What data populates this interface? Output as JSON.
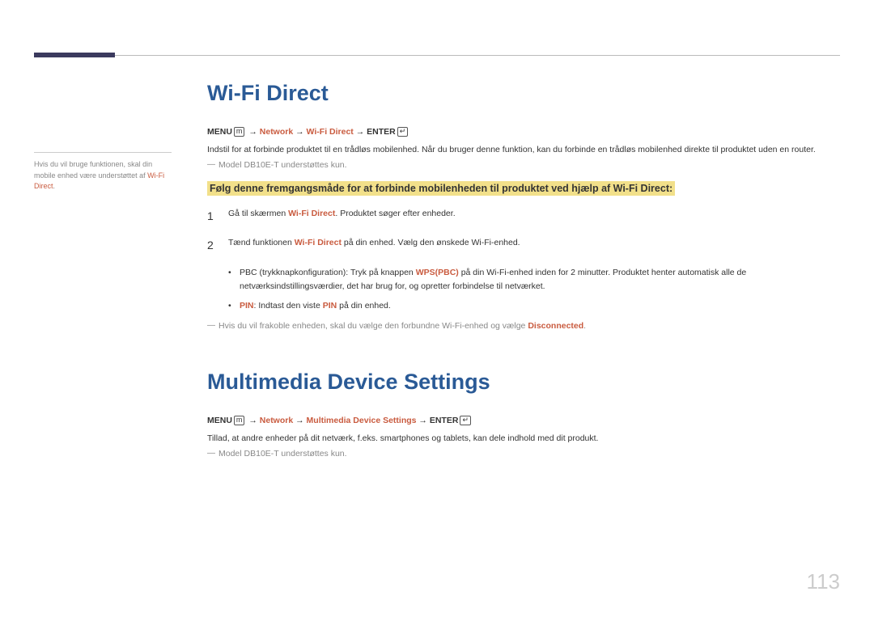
{
  "sidebar": {
    "text_a": "Hvis du vil bruge funktionen, skal din mobile enhed være understøttet af ",
    "hl": "Wi-Fi Direct",
    "text_b": "."
  },
  "section1": {
    "title": "Wi-Fi Direct",
    "path": {
      "menu": "MENU",
      "menu_icon": "m",
      "arrow1": " → ",
      "network": "Network",
      "arrow2": " → ",
      "item": "Wi-Fi Direct",
      "arrow3": " → ",
      "enter": "ENTER",
      "enter_icon": "↵"
    },
    "desc": "Indstil for at forbinde produktet til en trådløs mobilenhed. Når du bruger denne funktion, kan du forbinde en trådløs mobilenhed direkte til produktet uden en router.",
    "note": "Model DB10E-T understøttes kun.",
    "callout": "Følg denne fremgangsmåde for at forbinde mobilenheden til produktet ved hjælp af Wi-Fi Direct:",
    "step1": {
      "num": "1",
      "a": "Gå til skærmen ",
      "hl": "Wi-Fi Direct",
      "b": ". Produktet søger efter enheder."
    },
    "step2": {
      "num": "2",
      "a": "Tænd funktionen ",
      "hl": "Wi-Fi Direct",
      "b": " på din enhed. Vælg den ønskede Wi-Fi-enhed."
    },
    "bullet1": {
      "a": "PBC (trykknapkonfiguration): Tryk på knappen ",
      "hl": "WPS(PBC)",
      "b": " på din Wi-Fi-enhed inden for 2 minutter. Produktet henter automatisk alle de netværksindstillingsværdier, det har brug for, og opretter forbindelse til netværket."
    },
    "bullet2": {
      "hl1": "PIN",
      "a": ": Indtast den viste ",
      "hl2": "PIN",
      "b": " på din enhed."
    },
    "note2": {
      "a": "Hvis du vil frakoble enheden, skal du vælge den forbundne Wi-Fi-enhed og vælge ",
      "hl": "Disconnected",
      "b": "."
    }
  },
  "section2": {
    "title": "Multimedia Device Settings",
    "path": {
      "menu": "MENU",
      "menu_icon": "m",
      "arrow1": " → ",
      "network": "Network",
      "arrow2": " → ",
      "item": "Multimedia Device Settings",
      "arrow3": " → ",
      "enter": "ENTER",
      "enter_icon": "↵"
    },
    "desc": "Tillad, at andre enheder på dit netværk, f.eks. smartphones og tablets, kan dele indhold med dit produkt.",
    "note": "Model DB10E-T understøttes kun."
  },
  "page_number": "113"
}
